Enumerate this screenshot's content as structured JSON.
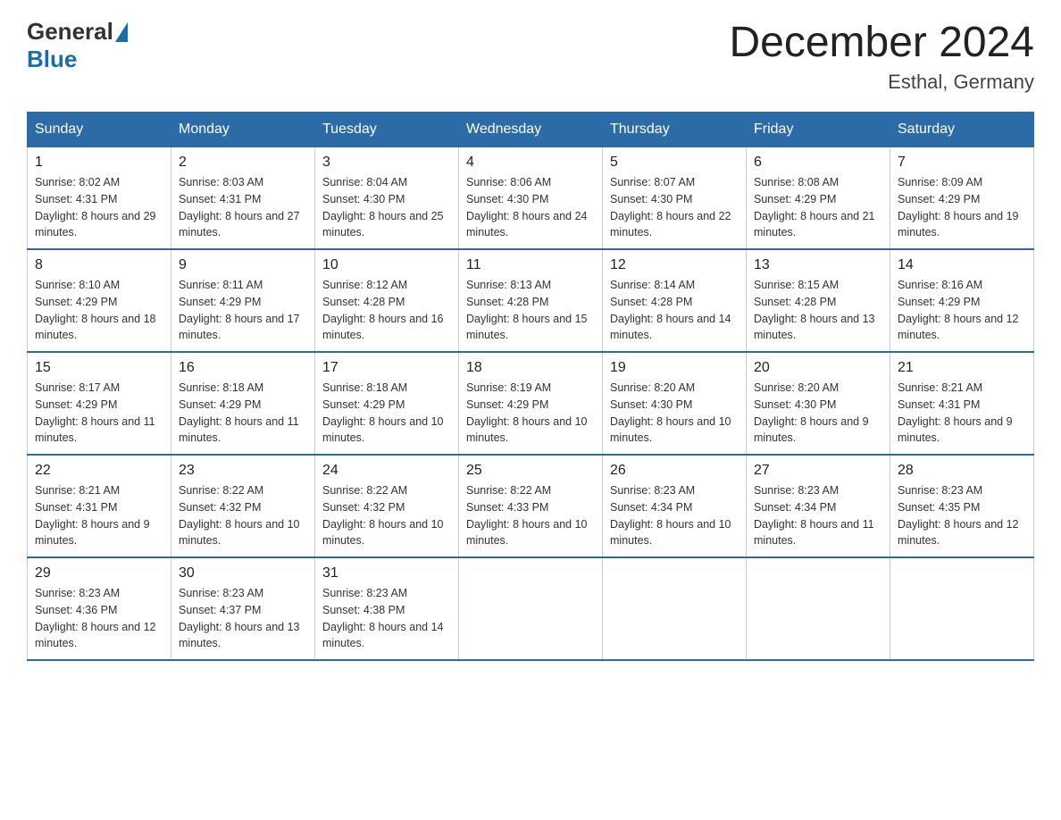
{
  "logo": {
    "text_general": "General",
    "text_blue": "Blue"
  },
  "title": "December 2024",
  "subtitle": "Esthal, Germany",
  "weekdays": [
    "Sunday",
    "Monday",
    "Tuesday",
    "Wednesday",
    "Thursday",
    "Friday",
    "Saturday"
  ],
  "weeks": [
    [
      {
        "day": "1",
        "sunrise": "8:02 AM",
        "sunset": "4:31 PM",
        "daylight": "8 hours and 29 minutes."
      },
      {
        "day": "2",
        "sunrise": "8:03 AM",
        "sunset": "4:31 PM",
        "daylight": "8 hours and 27 minutes."
      },
      {
        "day": "3",
        "sunrise": "8:04 AM",
        "sunset": "4:30 PM",
        "daylight": "8 hours and 25 minutes."
      },
      {
        "day": "4",
        "sunrise": "8:06 AM",
        "sunset": "4:30 PM",
        "daylight": "8 hours and 24 minutes."
      },
      {
        "day": "5",
        "sunrise": "8:07 AM",
        "sunset": "4:30 PM",
        "daylight": "8 hours and 22 minutes."
      },
      {
        "day": "6",
        "sunrise": "8:08 AM",
        "sunset": "4:29 PM",
        "daylight": "8 hours and 21 minutes."
      },
      {
        "day": "7",
        "sunrise": "8:09 AM",
        "sunset": "4:29 PM",
        "daylight": "8 hours and 19 minutes."
      }
    ],
    [
      {
        "day": "8",
        "sunrise": "8:10 AM",
        "sunset": "4:29 PM",
        "daylight": "8 hours and 18 minutes."
      },
      {
        "day": "9",
        "sunrise": "8:11 AM",
        "sunset": "4:29 PM",
        "daylight": "8 hours and 17 minutes."
      },
      {
        "day": "10",
        "sunrise": "8:12 AM",
        "sunset": "4:28 PM",
        "daylight": "8 hours and 16 minutes."
      },
      {
        "day": "11",
        "sunrise": "8:13 AM",
        "sunset": "4:28 PM",
        "daylight": "8 hours and 15 minutes."
      },
      {
        "day": "12",
        "sunrise": "8:14 AM",
        "sunset": "4:28 PM",
        "daylight": "8 hours and 14 minutes."
      },
      {
        "day": "13",
        "sunrise": "8:15 AM",
        "sunset": "4:28 PM",
        "daylight": "8 hours and 13 minutes."
      },
      {
        "day": "14",
        "sunrise": "8:16 AM",
        "sunset": "4:29 PM",
        "daylight": "8 hours and 12 minutes."
      }
    ],
    [
      {
        "day": "15",
        "sunrise": "8:17 AM",
        "sunset": "4:29 PM",
        "daylight": "8 hours and 11 minutes."
      },
      {
        "day": "16",
        "sunrise": "8:18 AM",
        "sunset": "4:29 PM",
        "daylight": "8 hours and 11 minutes."
      },
      {
        "day": "17",
        "sunrise": "8:18 AM",
        "sunset": "4:29 PM",
        "daylight": "8 hours and 10 minutes."
      },
      {
        "day": "18",
        "sunrise": "8:19 AM",
        "sunset": "4:29 PM",
        "daylight": "8 hours and 10 minutes."
      },
      {
        "day": "19",
        "sunrise": "8:20 AM",
        "sunset": "4:30 PM",
        "daylight": "8 hours and 10 minutes."
      },
      {
        "day": "20",
        "sunrise": "8:20 AM",
        "sunset": "4:30 PM",
        "daylight": "8 hours and 9 minutes."
      },
      {
        "day": "21",
        "sunrise": "8:21 AM",
        "sunset": "4:31 PM",
        "daylight": "8 hours and 9 minutes."
      }
    ],
    [
      {
        "day": "22",
        "sunrise": "8:21 AM",
        "sunset": "4:31 PM",
        "daylight": "8 hours and 9 minutes."
      },
      {
        "day": "23",
        "sunrise": "8:22 AM",
        "sunset": "4:32 PM",
        "daylight": "8 hours and 10 minutes."
      },
      {
        "day": "24",
        "sunrise": "8:22 AM",
        "sunset": "4:32 PM",
        "daylight": "8 hours and 10 minutes."
      },
      {
        "day": "25",
        "sunrise": "8:22 AM",
        "sunset": "4:33 PM",
        "daylight": "8 hours and 10 minutes."
      },
      {
        "day": "26",
        "sunrise": "8:23 AM",
        "sunset": "4:34 PM",
        "daylight": "8 hours and 10 minutes."
      },
      {
        "day": "27",
        "sunrise": "8:23 AM",
        "sunset": "4:34 PM",
        "daylight": "8 hours and 11 minutes."
      },
      {
        "day": "28",
        "sunrise": "8:23 AM",
        "sunset": "4:35 PM",
        "daylight": "8 hours and 12 minutes."
      }
    ],
    [
      {
        "day": "29",
        "sunrise": "8:23 AM",
        "sunset": "4:36 PM",
        "daylight": "8 hours and 12 minutes."
      },
      {
        "day": "30",
        "sunrise": "8:23 AM",
        "sunset": "4:37 PM",
        "daylight": "8 hours and 13 minutes."
      },
      {
        "day": "31",
        "sunrise": "8:23 AM",
        "sunset": "4:38 PM",
        "daylight": "8 hours and 14 minutes."
      },
      null,
      null,
      null,
      null
    ]
  ]
}
